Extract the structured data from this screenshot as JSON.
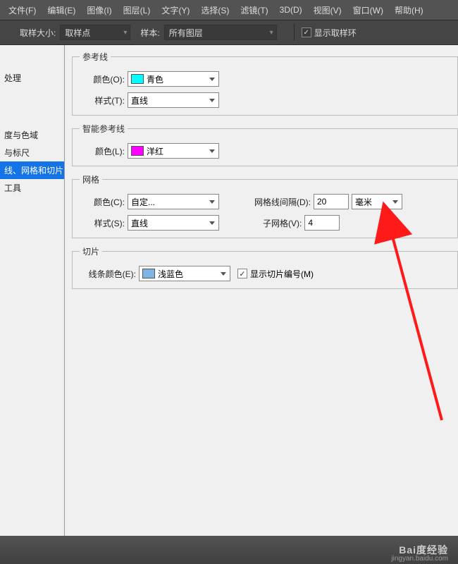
{
  "menubar": {
    "items": [
      "文件(F)",
      "编辑(E)",
      "图像(I)",
      "图层(L)",
      "文字(Y)",
      "选择(S)",
      "滤镜(T)",
      "3D(D)",
      "视图(V)",
      "窗口(W)",
      "帮助(H)"
    ]
  },
  "toolbar": {
    "sample_size_label": "取样大小:",
    "sample_size_value": "取样点",
    "sample_label": "样本:",
    "sample_value": "所有图层",
    "show_ring_checked": "✓",
    "show_ring_label": "显示取样环"
  },
  "sidebar": {
    "items": [
      {
        "label": "处理",
        "selected": false
      },
      {
        "label": "度与色域",
        "selected": false
      },
      {
        "label": "与标尺",
        "selected": false
      },
      {
        "label": "线、网格和切片",
        "selected": true
      },
      {
        "label": "工具",
        "selected": false
      }
    ]
  },
  "panel": {
    "guides": {
      "legend": "参考线",
      "color_label": "颜色(O):",
      "color_value": "青色",
      "style_label": "样式(T):",
      "style_value": "直线"
    },
    "smart_guides": {
      "legend": "智能参考线",
      "color_label": "颜色(L):",
      "color_value": "洋红"
    },
    "grid": {
      "legend": "网格",
      "color_label": "颜色(C):",
      "color_value": "自定...",
      "style_label": "样式(S):",
      "style_value": "直线",
      "spacing_label": "网格线间隔(D):",
      "spacing_value": "20",
      "spacing_unit": "毫米",
      "subgrid_label": "子网格(V):",
      "subgrid_value": "4"
    },
    "slice": {
      "legend": "切片",
      "color_label": "线条颜色(E):",
      "color_value": "浅蓝色",
      "show_number_checked": "✓",
      "show_number_label": "显示切片编号(M)"
    }
  },
  "footer": {
    "logo": "Bai度经验",
    "sub": "jingyan.baidu.com"
  }
}
